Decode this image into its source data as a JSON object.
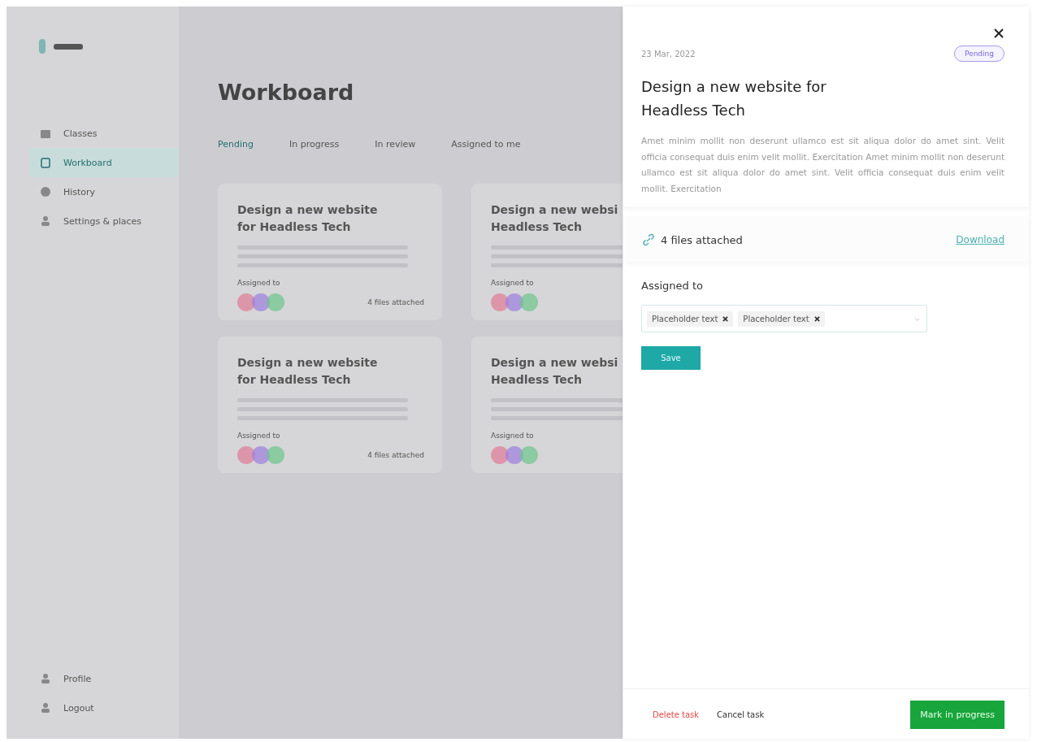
{
  "sidebar": {
    "items": [
      {
        "label": "Classes",
        "selected": false
      },
      {
        "label": "Workboard",
        "selected": true
      },
      {
        "label": "History",
        "selected": false
      },
      {
        "label": "Settings & places",
        "selected": false
      }
    ],
    "bottom_items": [
      {
        "label": "Profile"
      },
      {
        "label": "Logout"
      }
    ]
  },
  "main": {
    "title": "Workboard",
    "tabs": [
      {
        "label": "Pending",
        "selected": true
      },
      {
        "label": "In progress",
        "selected": false
      },
      {
        "label": "In review",
        "selected": false
      },
      {
        "label": "Assigned to me",
        "selected": false
      }
    ],
    "cards": [
      {
        "title": "Design a new website for Headless Tech",
        "assigned_label": "Assigned to",
        "files": "4 files attached"
      },
      {
        "title": "Design a new websi Headless Tech",
        "assigned_label": "Assigned to"
      },
      {
        "title": "Design a new website for Headless Tech",
        "assigned_label": "Assigned to",
        "files": "4 files attached"
      },
      {
        "title": "Design a new websi Headless Tech",
        "assigned_label": "Assigned to"
      }
    ]
  },
  "drawer": {
    "date": "23 Mar, 2022",
    "status": "Pending",
    "title": "Design a new website for Headless Tech",
    "description": "Amet minim mollit non deserunt ullamco est sit aliqua dolor do amet sint. Velit officia consequat duis enim velit mollit. Exercitation Amet minim mollit non deserunt ullamco est sit aliqua dolor do amet sint. Velit officia consequat duis enim velit mollit. Exercitation",
    "files": "4 files attached",
    "download": "Download",
    "assigned_label": "Assigned to",
    "assignees": [
      "Placeholder text",
      "Placeholder text"
    ],
    "save": "Save",
    "delete": "Delete task",
    "cancel": "Cancel task",
    "primary": "Mark in progress"
  }
}
